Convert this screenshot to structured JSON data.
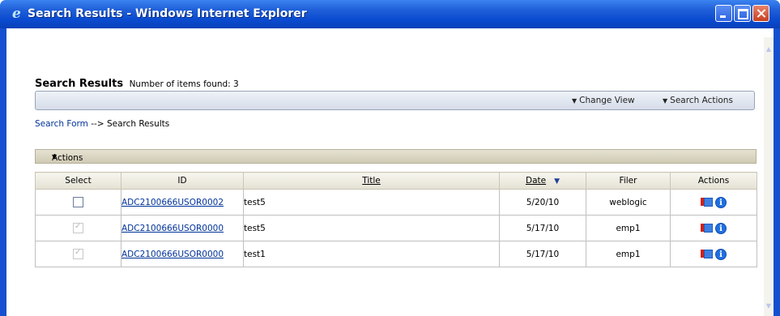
{
  "window": {
    "title": "Search Results - Windows Internet Explorer",
    "app_icon": "ie-icon",
    "buttons": [
      "minimize",
      "maximize",
      "close"
    ]
  },
  "page": {
    "title": "Search Results",
    "items_found": "Number of items found: 3"
  },
  "toolbar": {
    "change_view": "Change View",
    "search_actions": "Search Actions"
  },
  "breadcrumb": {
    "link": "Search Form",
    "separator": " --> ",
    "current": "Search Results"
  },
  "panel": {
    "header": "Actions"
  },
  "table": {
    "columns": [
      "Select",
      "ID",
      "Title",
      "Date",
      "Filer",
      "Actions"
    ],
    "sorted_column": "Date",
    "sort_direction": "descending",
    "rows": [
      {
        "selected": false,
        "disabled": false,
        "id": "ADC2100666USOR0002",
        "title": "test5",
        "date": "5/20/10",
        "filer": "weblogic"
      },
      {
        "selected": true,
        "disabled": true,
        "id": "ADC2100666USOR0000",
        "title": "test5",
        "date": "5/17/10",
        "filer": "emp1"
      },
      {
        "selected": true,
        "disabled": true,
        "id": "ADC2100666USOR0000",
        "title": "test1",
        "date": "5/17/10",
        "filer": "emp1"
      }
    ]
  },
  "colors": {
    "titlebar": "#0a4bd0",
    "link": "#003399",
    "panel_header": "#cfcab3"
  }
}
